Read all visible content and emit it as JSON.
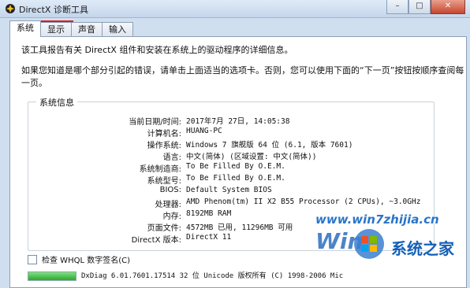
{
  "window": {
    "title": "DirectX 诊断工具",
    "controls": [
      "minimize",
      "maximize",
      "close"
    ]
  },
  "tabs": [
    {
      "label": "系统",
      "active": true
    },
    {
      "label": "显示",
      "highlighted": true
    },
    {
      "label": "声音"
    },
    {
      "label": "输入"
    }
  ],
  "intro": {
    "line1": "该工具报告有关 DirectX 组件和安装在系统上的驱动程序的详细信息。",
    "line2": "如果您知道是哪个部分引起的错误，请单击上面适当的选项卡。否则，您可以使用下面的“下一页”按钮按顺序查阅每一页。"
  },
  "system_info": {
    "title": "系统信息",
    "rows": [
      {
        "label": "当前日期/时间:",
        "value": "2017年7月 27日, 14:05:38"
      },
      {
        "label": "计算机名:",
        "value": "HUANG-PC"
      },
      {
        "label": "操作系统:",
        "value": "Windows 7 旗舰版 64 位 (6.1, 版本 7601)"
      },
      {
        "label": "语言:",
        "value": "中文(简体) (区域设置: 中文(简体))"
      },
      {
        "label": "系统制造商:",
        "value": "To Be Filled By O.E.M."
      },
      {
        "label": "系统型号:",
        "value": "To Be Filled By O.E.M."
      },
      {
        "label": "BIOS:",
        "value": "Default System BIOS"
      },
      {
        "label": "处理器:",
        "value": "AMD Phenom(tm) II X2 B55 Processor (2 CPUs), ~3.0GHz"
      },
      {
        "label": "内存:",
        "value": "8192MB RAM"
      },
      {
        "label": "页面文件:",
        "value": "4572MB 已用, 11296MB 可用"
      },
      {
        "label": "DirectX 版本:",
        "value": "DirectX 11"
      }
    ]
  },
  "whql": {
    "label": "检查 WHQL 数字签名(C)",
    "checked": false
  },
  "status": {
    "progress": 1.0,
    "copyright": "DxDiag 6.01.7601.17514 32 位 Unicode 版权所有 (C) 1998-2006 Mic"
  },
  "watermark": {
    "url": "www.win7zhijia.cn",
    "brand": "系统之家",
    "word": "Win"
  },
  "colors": {
    "highlight": "#e0191e",
    "titlebar": "#c4d6ec",
    "watermark_blue": "#2a75c9"
  }
}
